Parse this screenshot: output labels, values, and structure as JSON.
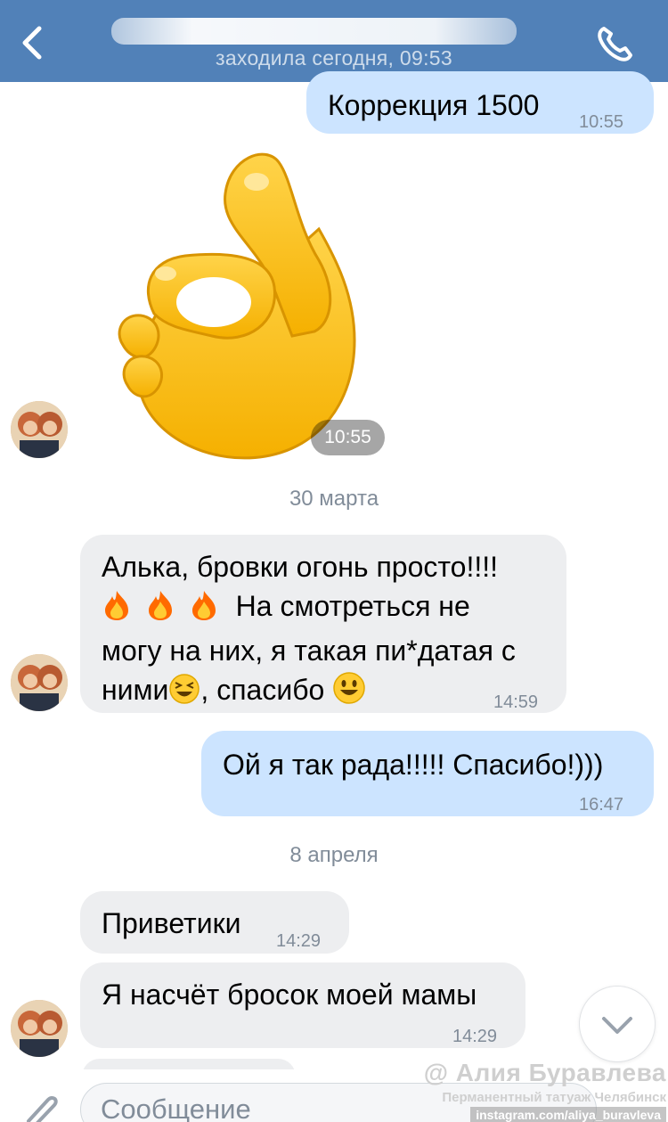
{
  "header": {
    "status": "заходила сегодня, 09:53",
    "background": "#5181b8"
  },
  "messages": [
    {
      "dir": "out",
      "text": "Коррекция 1500",
      "time": "10:55"
    },
    {
      "dir": "in",
      "type": "sticker",
      "sticker": "ok-hand",
      "time": "10:55"
    },
    {
      "dir": "in",
      "line1": "Алька,  бровки огонь просто!!!!",
      "line2": "На смотреться не",
      "line3": "могу на них, я такая пи*датая с",
      "line4a": "ними",
      "line4b": ", спасибо",
      "time": "14:59"
    },
    {
      "dir": "out",
      "text": "Ой я так рада!!!!! Спасибо!)))",
      "time": "16:47"
    },
    {
      "dir": "in",
      "text": "Приветики",
      "time": "14:29"
    },
    {
      "dir": "in",
      "text": "Я насчёт бросок моей мамы",
      "time": "14:29"
    }
  ],
  "dates": [
    "30 марта",
    "8 апреля"
  ],
  "composer": {
    "placeholder": "Сообщение"
  },
  "watermark": {
    "name": "@ Алия Буравлева",
    "subtitle": "Перманентный татуаж Челябинск",
    "url": "instagram.com/aliya_buravleva"
  },
  "colors": {
    "outgoing": "#cce4ff",
    "incoming": "#edeef0",
    "time": "#818c99"
  },
  "icons": [
    "back-icon",
    "phone-icon",
    "fire-icon",
    "laughing-emoji-icon",
    "smiley-emoji-icon",
    "chevron-down-icon",
    "paperclip-icon"
  ]
}
